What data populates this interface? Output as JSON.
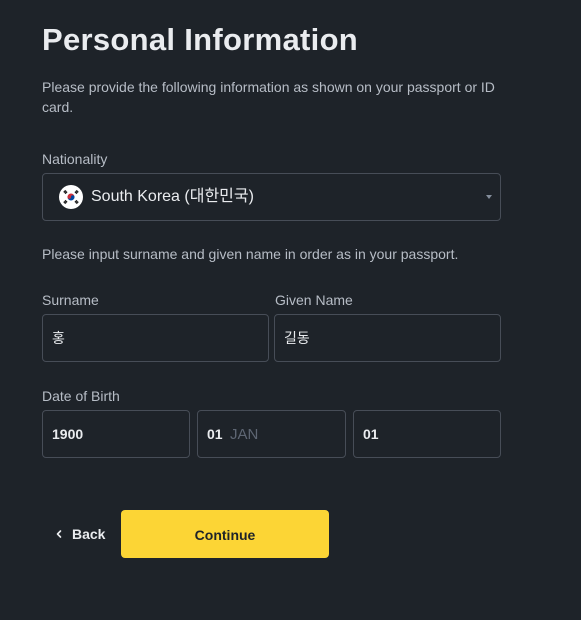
{
  "header": {
    "title": "Personal Information",
    "subtitle": "Please provide the following information as shown on your passport or ID card."
  },
  "nationality": {
    "label": "Nationality",
    "selected": "South Korea (대한민국)",
    "flag_icon": "south-korea-flag-icon"
  },
  "name_instruction": "Please input surname and given name in order as in your passport.",
  "surname": {
    "label": "Surname",
    "value": "홍"
  },
  "given_name": {
    "label": "Given Name",
    "value": "길동"
  },
  "date_of_birth": {
    "label": "Date of Birth",
    "year": "1900",
    "month": "01",
    "month_placeholder": "JAN",
    "day": "01"
  },
  "actions": {
    "back_label": "Back",
    "continue_label": "Continue"
  },
  "colors": {
    "background": "#1e2329",
    "accent": "#fcd535",
    "border": "#474d57"
  }
}
